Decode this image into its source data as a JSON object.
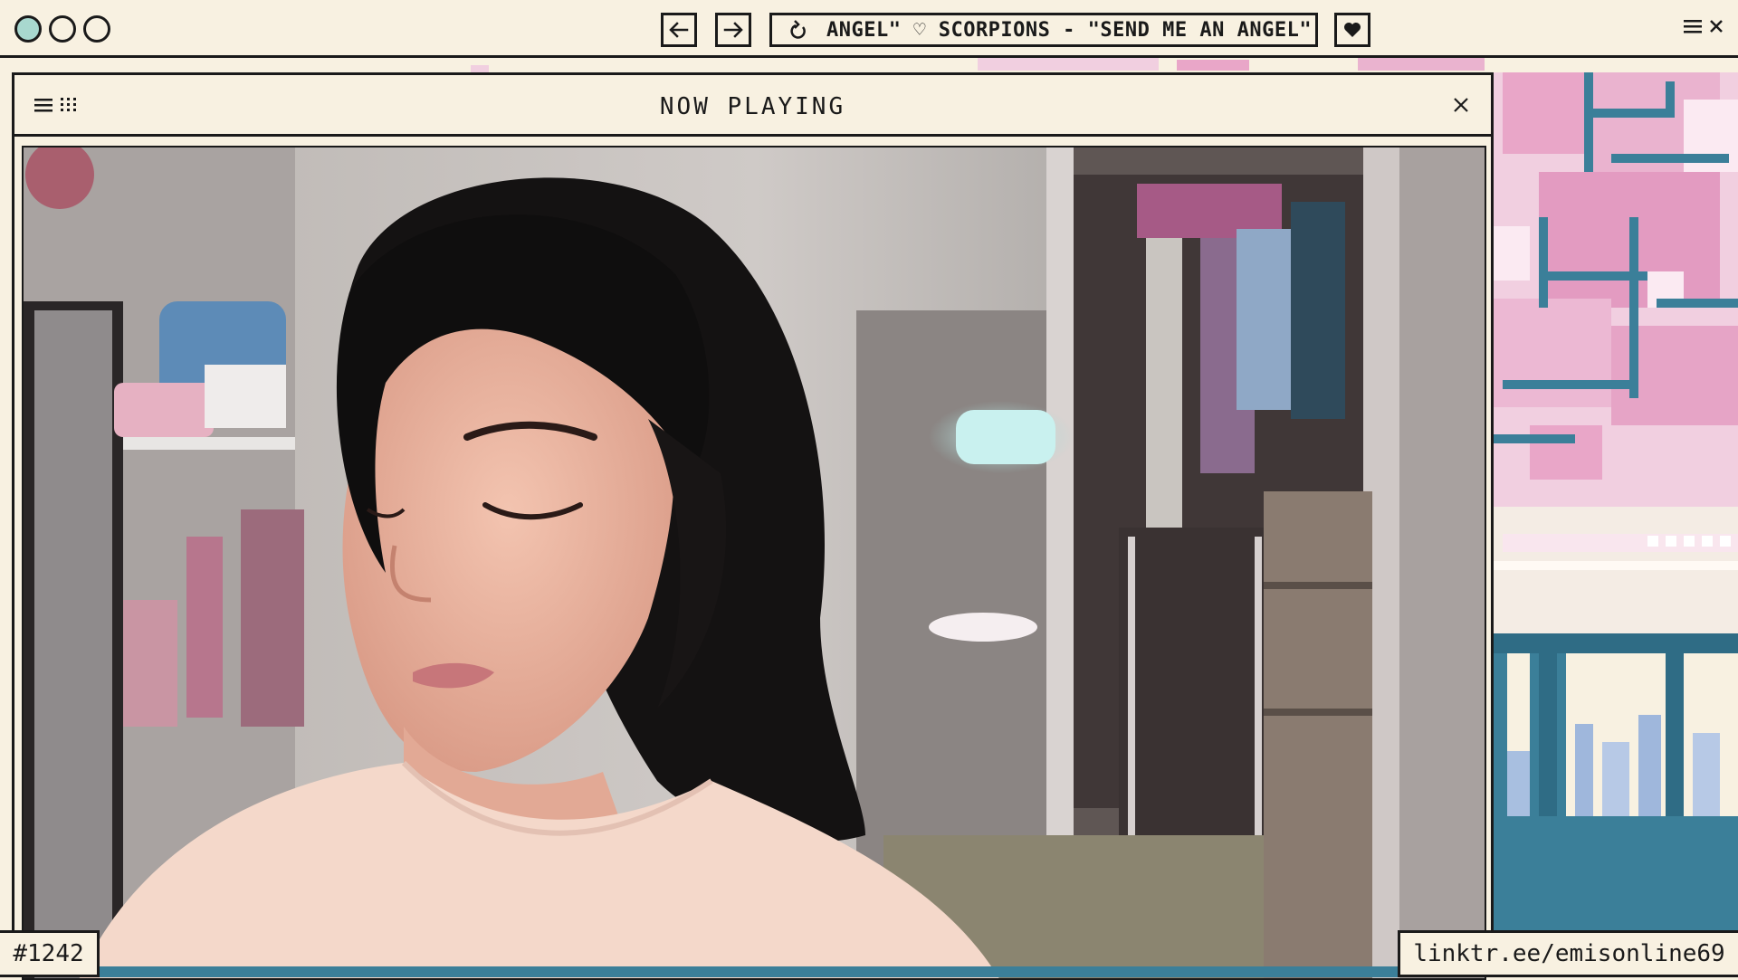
{
  "window": {
    "traffic_lights": [
      "teal-dot",
      "empty-dot",
      "empty-dot"
    ],
    "nav_back_icon": "arrow-left-icon",
    "nav_forward_icon": "arrow-right-icon"
  },
  "address_bar": {
    "icon": "reload-icon",
    "marquee": "ANGEL\" ♡ SCORPIONS - \"SEND ME AN ANGEL\" ♡ S"
  },
  "toolbar": {
    "heart_icon": "heart-icon",
    "menu_icon": "menu-icon",
    "close_icon": "close-icon"
  },
  "player": {
    "title": "NOW PLAYING",
    "list_icon": "list-icon",
    "grid_icon": "grid-icon",
    "close_icon": "close-icon"
  },
  "badges": {
    "counter": "#1242",
    "link": "linktr.ee/emisonline69"
  },
  "colors": {
    "cream": "#f8f1e1",
    "ink": "#1a1a1a",
    "teal": "#a8d8cf",
    "sakura_pink": "#e9a6c8",
    "trunk_blue": "#3b7f99"
  }
}
